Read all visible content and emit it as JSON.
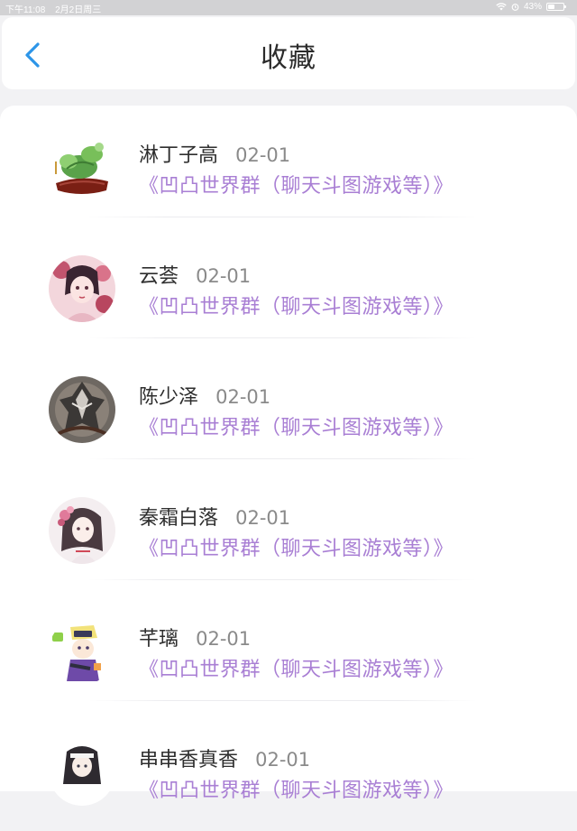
{
  "status_bar": {
    "time": "下午11:08",
    "date": "2月2日周三",
    "battery_percent": "43%",
    "battery_level": 0.43
  },
  "header": {
    "title": "收藏",
    "back_icon": "chevron-left-icon",
    "accent_color": "#2d95e8"
  },
  "favorites": [
    {
      "name": "淋丁子高",
      "date": "02-01",
      "group": "《凹凸世界群（聊天斗图游戏等）》",
      "avatar": "jade-carving"
    },
    {
      "name": "云荟",
      "date": "02-01",
      "group": "《凹凸世界群（聊天斗图游戏等）》",
      "avatar": "anime-girl-pink"
    },
    {
      "name": "陈少泽",
      "date": "02-01",
      "group": "《凹凸世界群（聊天斗图游戏等）》",
      "avatar": "armored-knight"
    },
    {
      "name": "秦霜白落",
      "date": "02-01",
      "group": "《凹凸世界群（聊天斗图游戏等）》",
      "avatar": "anime-girl-flowers"
    },
    {
      "name": "芊璃",
      "date": "02-01",
      "group": "《凹凸世界群（聊天斗图游戏等）》",
      "avatar": "chibi-character"
    },
    {
      "name": "串串香真香",
      "date": "02-01",
      "group": "《凹凸世界群（聊天斗图游戏等）》",
      "avatar": "nun-character"
    }
  ],
  "colors": {
    "group_text": "#a97fd4",
    "name_text": "#2e2e2e",
    "date_text": "#8a8a8a",
    "background": "#f2f2f4"
  }
}
